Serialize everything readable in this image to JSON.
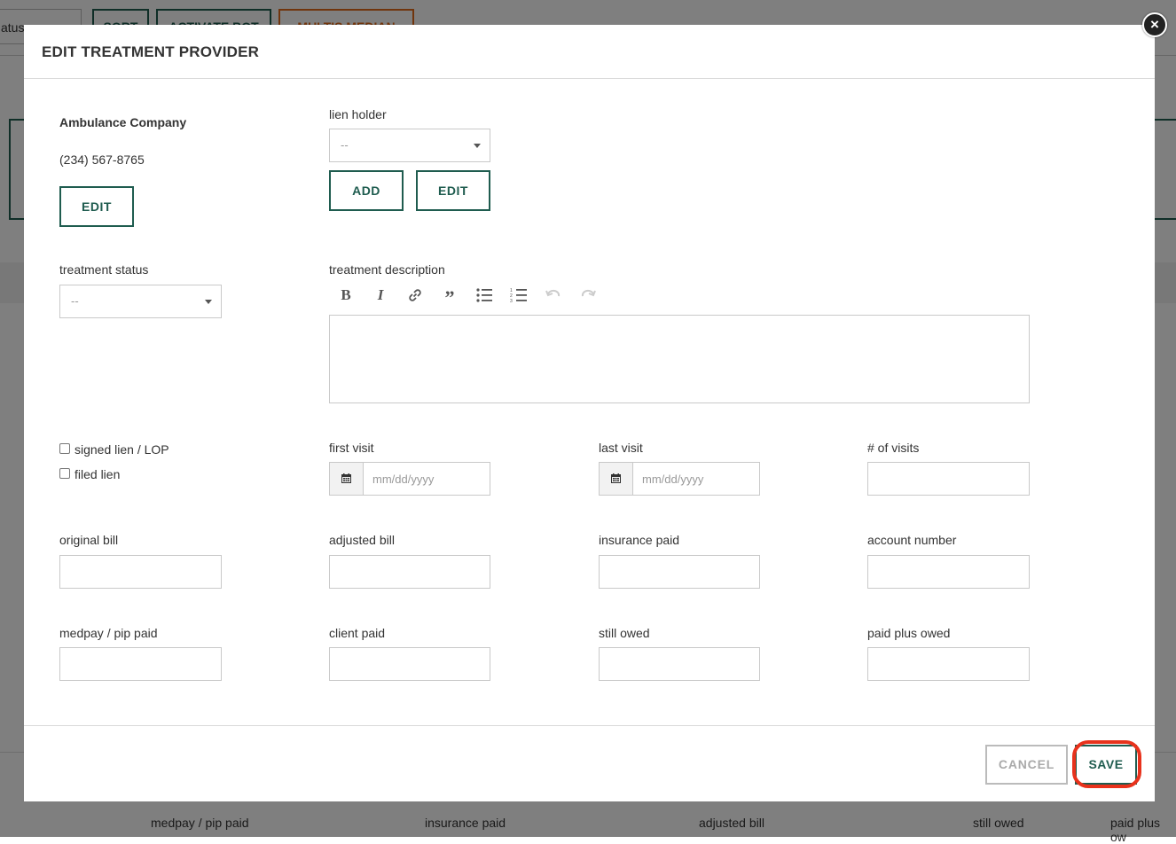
{
  "background": {
    "status_select_label": "atus",
    "toolbar_buttons": [
      "SORT",
      "ACTIVATE BOT",
      "MULTIS MEDIAN"
    ],
    "footer_labels": [
      "medpay / pip paid",
      "insurance paid",
      "adjusted bill",
      "still owed",
      "paid plus ow"
    ]
  },
  "modal": {
    "title": "EDIT TREATMENT PROVIDER",
    "close_symbol": "×",
    "provider": {
      "name": "Ambulance Company",
      "phone": "(234) 567-8765",
      "edit_label": "EDIT"
    },
    "lien_holder": {
      "label": "lien holder",
      "value": "--",
      "add_label": "ADD",
      "edit_label": "EDIT"
    },
    "treatment_status": {
      "label": "treatment status",
      "value": "--"
    },
    "treatment_description": {
      "label": "treatment description",
      "toolbar": [
        "bold-icon",
        "italic-icon",
        "link-icon",
        "quote-icon",
        "bullet-list-icon",
        "numbered-list-icon",
        "undo-icon",
        "redo-icon"
      ],
      "value": ""
    },
    "checkboxes": [
      {
        "label": "signed lien / LOP",
        "checked": false
      },
      {
        "label": "filed lien",
        "checked": false
      }
    ],
    "dates": {
      "first_visit_label": "first visit",
      "first_visit_placeholder": "mm/dd/yyyy",
      "last_visit_label": "last visit",
      "last_visit_placeholder": "mm/dd/yyyy"
    },
    "fields": {
      "num_visits": "# of visits",
      "original_bill": "original bill",
      "adjusted_bill": "adjusted bill",
      "insurance_paid": "insurance paid",
      "account_number": "account number",
      "medpay_pip_paid": "medpay / pip paid",
      "client_paid": "client paid",
      "still_owed": "still owed",
      "paid_plus_owed": "paid plus owed"
    },
    "footer": {
      "cancel_label": "CANCEL",
      "save_label": "SAVE"
    }
  },
  "colors": {
    "brand_green": "#1f5c4f",
    "highlight_red": "#e8321c",
    "accent_orange": "#e06a1a"
  }
}
